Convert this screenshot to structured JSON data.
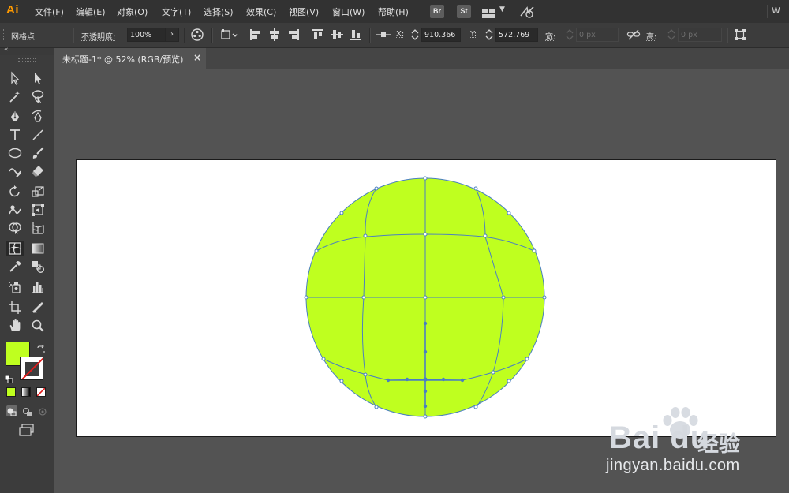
{
  "app": {
    "logo": "Ai",
    "top_right_fragment": "W"
  },
  "menu": {
    "items": [
      "文件(F)",
      "编辑(E)",
      "对象(O)",
      "文字(T)",
      "选择(S)",
      "效果(C)",
      "视图(V)",
      "窗口(W)",
      "帮助(H)"
    ],
    "bridge_label": "Br",
    "stock_label": "St"
  },
  "control_bar": {
    "selection_label": "网格点",
    "opacity_label": "不透明度",
    "opacity_value": "100%",
    "x_label": "X",
    "x_value": "910.366",
    "y_label": "Y",
    "y_value": "572.769",
    "w_label": "宽",
    "w_value": "0 px",
    "h_label": "高",
    "h_value": "0 px"
  },
  "document": {
    "tab_title": "未标题-1* @ 52% (RGB/预览)",
    "close_label": "×"
  },
  "tools": {
    "fill_color": "#bfff1f",
    "stroke_color": "none",
    "icons": [
      "selection-tool-icon",
      "direct-selection-tool-icon",
      "magic-wand-tool-icon",
      "lasso-tool-icon",
      "pen-tool-icon",
      "curvature-tool-icon",
      "type-tool-icon",
      "line-segment-tool-icon",
      "ellipse-tool-icon",
      "paintbrush-tool-icon",
      "shaper-tool-icon",
      "eraser-tool-icon",
      "rotate-tool-icon",
      "scale-tool-icon",
      "warp-tool-icon",
      "free-transform-tool-icon",
      "shape-builder-tool-icon",
      "perspective-grid-tool-icon",
      "mesh-tool-icon",
      "gradient-tool-icon",
      "eyedropper-tool-icon",
      "blend-tool-icon",
      "symbol-sprayer-tool-icon",
      "column-graph-tool-icon",
      "artboard-tool-icon",
      "slice-tool-icon",
      "hand-tool-icon",
      "zoom-tool-icon"
    ]
  },
  "artwork": {
    "object": "gradient-mesh-circle",
    "fill": "#bfff1f",
    "mesh_line_color": "#4a7fc1"
  },
  "watermark": {
    "brand": "Bai du",
    "cn": "经验",
    "url": "jingyan.baidu.com"
  }
}
